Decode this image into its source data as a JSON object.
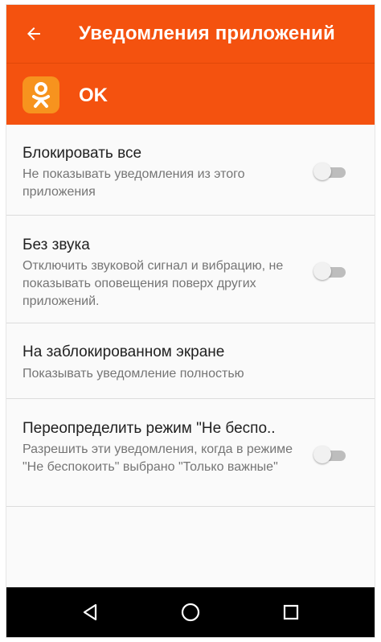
{
  "toolbar": {
    "title": "Уведомления приложений",
    "back_icon": "arrow-back-icon",
    "background": "#f4520f"
  },
  "app": {
    "name": "OK",
    "icon": "odnoklassniki-logo-icon",
    "icon_color": "#f7931e"
  },
  "settings": [
    {
      "title": "Блокировать все",
      "subtitle": "Не показывать уведомления из этого приложения",
      "switch_on": false
    },
    {
      "title": "Без звука",
      "subtitle": "Отключить звуковой сигнал и вибрацию, не показывать оповещения поверх других приложений.",
      "switch_on": false
    },
    {
      "title": "На заблокированном экране",
      "subtitle": "Показывать уведомление полностью"
    },
    {
      "title": "Переопределить режим \"Не беспо..",
      "subtitle": "Разрешить эти уведомления, когда в режиме \"Не беспокоить\" выбрано \"Только важные\"",
      "switch_on": false
    }
  ],
  "navbar": {
    "back_icon": "nav-back-icon",
    "home_icon": "nav-home-icon",
    "recents_icon": "nav-recents-icon"
  }
}
